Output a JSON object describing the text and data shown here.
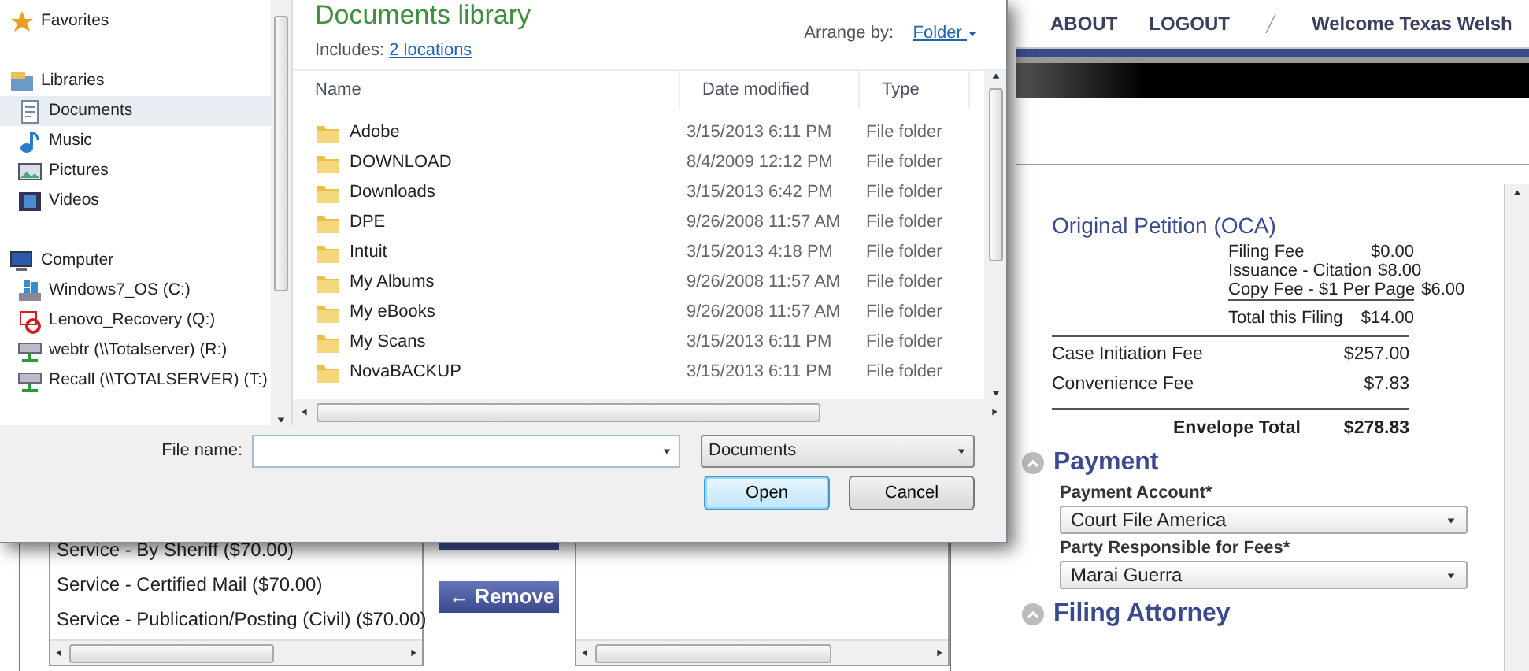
{
  "dialog": {
    "nav": [
      {
        "label": "Favorites",
        "kind": "favorites",
        "selected": false
      },
      {
        "label": "Libraries",
        "kind": "libraries",
        "selected": false,
        "children": [
          {
            "label": "Documents",
            "kind": "documents",
            "selected": true
          },
          {
            "label": "Music",
            "kind": "music",
            "selected": false
          },
          {
            "label": "Pictures",
            "kind": "pictures",
            "selected": false
          },
          {
            "label": "Videos",
            "kind": "videos",
            "selected": false
          }
        ]
      },
      {
        "label": "Computer",
        "kind": "computer",
        "selected": false,
        "children": [
          {
            "label": "Windows7_OS (C:)",
            "kind": "drive",
            "selected": false
          },
          {
            "label": "Lenovo_Recovery (Q:)",
            "kind": "recovery",
            "selected": false
          },
          {
            "label": "webtr (\\\\Totalserver) (R:)",
            "kind": "network",
            "selected": false
          },
          {
            "label": "Recall (\\\\TOTALSERVER) (T:)",
            "kind": "network",
            "selected": false
          }
        ]
      }
    ],
    "library_title": "Documents library",
    "includes_label": "Includes:",
    "includes_link": "2 locations",
    "arrange_label": "Arrange by:",
    "arrange_value": "Folder",
    "columns": [
      "Name",
      "Date modified",
      "Type"
    ],
    "files": [
      {
        "name": "Adobe",
        "date": "3/15/2013 6:11 PM",
        "type": "File folder"
      },
      {
        "name": "DOWNLOAD",
        "date": "8/4/2009 12:12 PM",
        "type": "File folder"
      },
      {
        "name": "Downloads",
        "date": "3/15/2013 6:42 PM",
        "type": "File folder"
      },
      {
        "name": "DPE",
        "date": "9/26/2008 11:57 AM",
        "type": "File folder"
      },
      {
        "name": "Intuit",
        "date": "3/15/2013 4:18 PM",
        "type": "File folder"
      },
      {
        "name": "My Albums",
        "date": "9/26/2008 11:57 AM",
        "type": "File folder"
      },
      {
        "name": "My eBooks",
        "date": "9/26/2008 11:57 AM",
        "type": "File folder"
      },
      {
        "name": "My Scans",
        "date": "3/15/2013 6:11 PM",
        "type": "File folder"
      },
      {
        "name": "NovaBACKUP",
        "date": "3/15/2013 6:11 PM",
        "type": "File folder"
      }
    ],
    "file_name_label": "File name:",
    "filter": "Documents",
    "buttons": [
      {
        "label": "Open",
        "default": true
      },
      {
        "label": "Cancel",
        "default": false
      }
    ]
  },
  "page": {
    "nav": [
      "ABOUT",
      "LOGOUT"
    ],
    "welcome": "Welcome Texas Welsh",
    "services": [
      "Service - By Sheriff ($70.00)",
      "Service - Certified Mail ($70.00)",
      "Service - Publication/Posting (Civil) ($70.00)"
    ],
    "remove_button": "← Remove",
    "fees": {
      "filing": "Original Petition (OCA)",
      "items": [
        {
          "label": "Filing Fee",
          "amount": "$0.00"
        },
        {
          "label": "Issuance - Citation",
          "amount": "$8.00"
        },
        {
          "label": "Copy Fee - $1 Per Page",
          "amount": "$6.00"
        }
      ],
      "filing_total": {
        "label": "Total this Filing",
        "amount": "$14.00"
      },
      "extra": [
        {
          "label": "Case Initiation Fee",
          "amount": "$257.00"
        },
        {
          "label": "Convenience Fee",
          "amount": "$7.83"
        }
      ],
      "envelope_total": {
        "label": "Envelope Total",
        "amount": "$278.83"
      }
    },
    "payment": {
      "title": "Payment",
      "fields": [
        {
          "label": "Payment Account*",
          "value": "Court File America"
        },
        {
          "label": "Party Responsible for Fees*",
          "value": "Marai Guerra"
        }
      ]
    },
    "filing_attorney": {
      "title": "Filing Attorney"
    }
  }
}
